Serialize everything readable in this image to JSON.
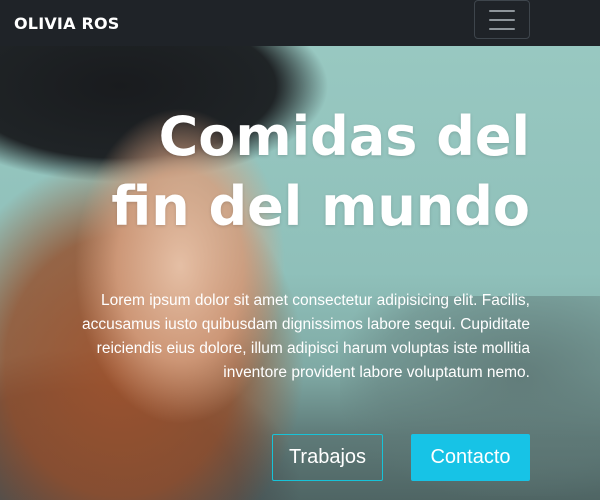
{
  "navbar": {
    "brand": "OLIVIA ROS",
    "menu_icon": "hamburger-menu-icon"
  },
  "hero": {
    "title": "Comidas del fin del mundo",
    "lead": "Lorem ipsum dolor sit amet consectetur adipisicing elit. Facilis, accusamus iusto quibusdam dignissimos labore sequi. Cupiditate reiciendis eius dolore, illum adipisci harum voluptas iste mollitia inventore provident labore voluptatum nemo.",
    "buttons": {
      "secondary": "Trabajos",
      "primary": "Contacto"
    }
  },
  "colors": {
    "navbar_bg": "#1f2328",
    "accent": "#17c3e6",
    "text": "#ffffff"
  }
}
